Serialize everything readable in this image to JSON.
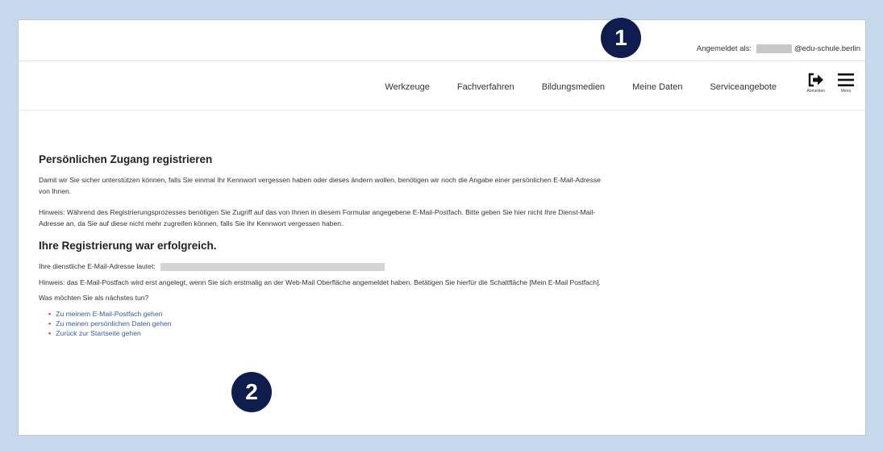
{
  "header": {
    "login_label": "Angemeldet als:",
    "login_domain": "@edu-schule.berlin"
  },
  "nav": {
    "items": [
      {
        "label": "Werkzeuge"
      },
      {
        "label": "Fachverfahren"
      },
      {
        "label": "Bildungsmedien"
      },
      {
        "label": "Meine Daten"
      },
      {
        "label": "Serviceangebote"
      }
    ],
    "logout_label": "Abmelden",
    "menu_label": "Menü"
  },
  "content": {
    "title": "Persönlichen Zugang registrieren",
    "intro": "Damit wir Sie sicher unterstützen können, falls Sie einmal Ihr Kennwort vergessen haben oder dieses ändern wollen, benötigen wir noch die Angabe einer persönlichen E-Mail-Adresse von Ihnen.",
    "hint": "Hinweis: Während des Registrierungsprozesses benötigen Sie Zugriff auf das von Ihnen in diesem Formular angegebene E-Mail-Postfach. Bitte geben Sie hier nicht Ihre Dienst-Mail-Adresse an, da Sie auf diese nicht mehr zugreifen können, falls Sie Ihr Kennwort vergessen haben.",
    "success_title": "Ihre Registrierung war erfolgreich.",
    "email_label": "Ihre dienstliche E-Mail-Adresse lautet:",
    "postfach_hint": "Hinweis: das E-Mail-Postfach wird erst angelegt, wenn Sie sich erstmalig an der Web-Mail Oberfläche angemeldet haben. Betätigen Sie hierfür die Schaltfläche [Mein E-Mail Postfach].",
    "question": "Was möchten Sie als nächstes tun?",
    "links": [
      {
        "label": "Zu meinem E-Mail-Postfach gehen"
      },
      {
        "label": "Zu meinen persönlichen Daten gehen"
      },
      {
        "label": "Zurück zur Startseite gehen"
      }
    ]
  },
  "markers": [
    {
      "label": "1"
    },
    {
      "label": "2"
    }
  ],
  "colors": {
    "background": "#c5d8ec",
    "marker": "#0f1d4e",
    "link": "#3a5a9a",
    "bullet": "#dd3333"
  }
}
